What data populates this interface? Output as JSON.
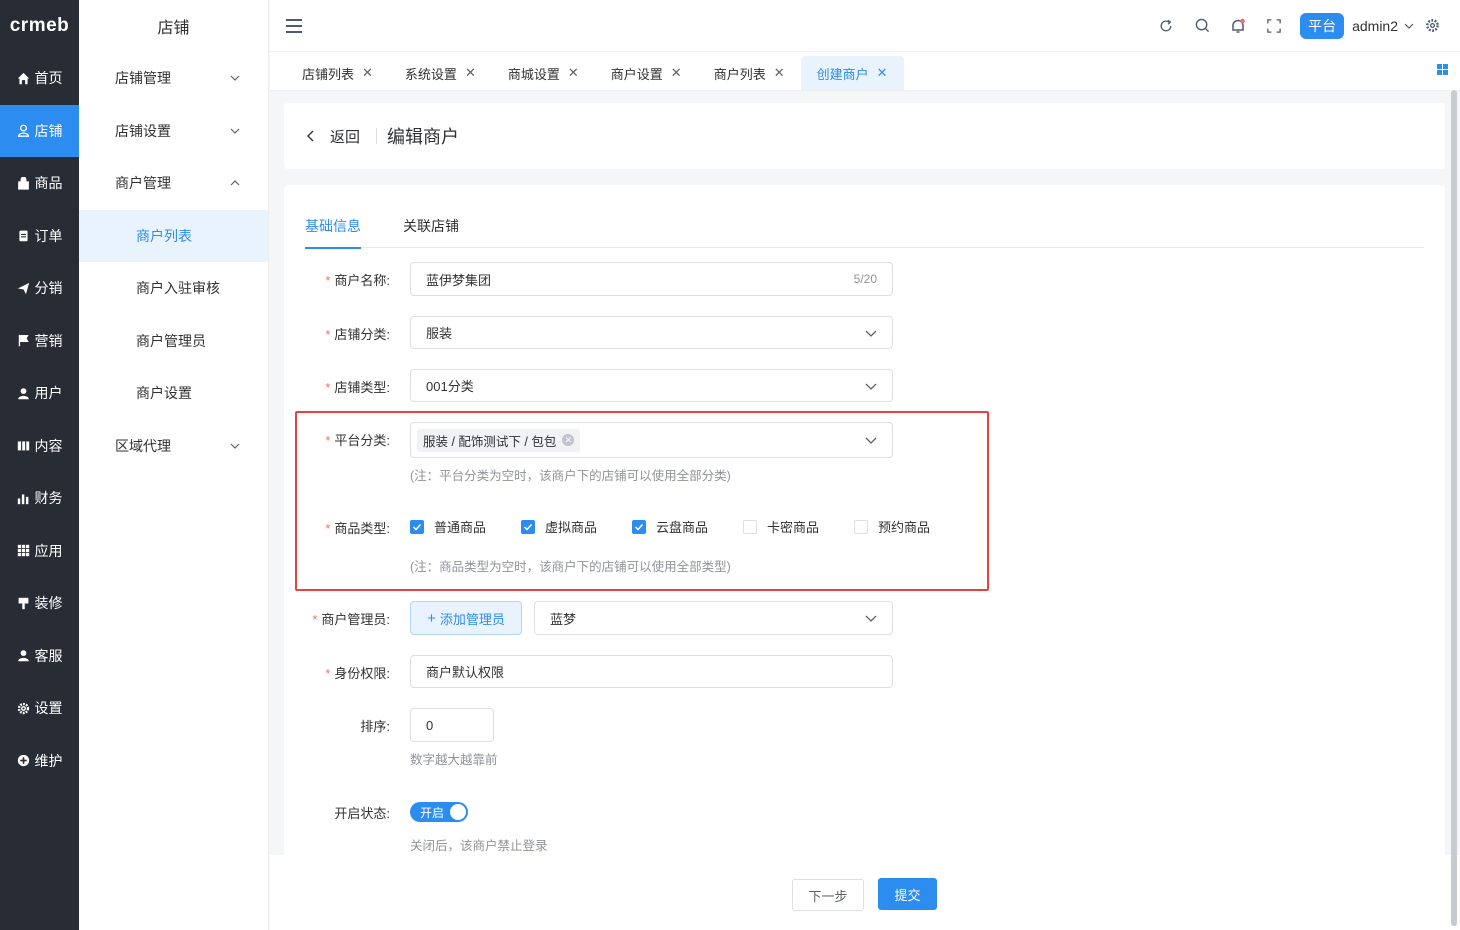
{
  "logo": "crmeb",
  "rail": {
    "items": [
      {
        "label": "首页",
        "icon": "home-icon"
      },
      {
        "label": "店铺",
        "icon": "store-icon",
        "active": true
      },
      {
        "label": "商品",
        "icon": "goods-icon"
      },
      {
        "label": "订单",
        "icon": "order-icon"
      },
      {
        "label": "分销",
        "icon": "distribution-icon"
      },
      {
        "label": "营销",
        "icon": "flag-icon"
      },
      {
        "label": "用户",
        "icon": "user-icon"
      },
      {
        "label": "内容",
        "icon": "content-icon"
      },
      {
        "label": "财务",
        "icon": "finance-icon"
      },
      {
        "label": "应用",
        "icon": "apps-icon"
      },
      {
        "label": "装修",
        "icon": "decorate-icon"
      },
      {
        "label": "客服",
        "icon": "service-icon"
      },
      {
        "label": "设置",
        "icon": "settings-icon"
      },
      {
        "label": "维护",
        "icon": "maintain-icon"
      }
    ]
  },
  "submenu": {
    "title": "店铺",
    "groups": [
      {
        "label": "店铺管理"
      },
      {
        "label": "店铺设置"
      },
      {
        "label": "商户管理"
      },
      {
        "label": "区域代理"
      }
    ],
    "items": [
      {
        "label": "商户列表",
        "active": true
      },
      {
        "label": "商户入驻审核"
      },
      {
        "label": "商户管理员"
      },
      {
        "label": "商户设置"
      }
    ]
  },
  "header": {
    "platform_label": "平台",
    "user": "admin2"
  },
  "tabs": [
    {
      "label": "店铺列表"
    },
    {
      "label": "系统设置"
    },
    {
      "label": "商城设置"
    },
    {
      "label": "商户设置"
    },
    {
      "label": "商户列表"
    },
    {
      "label": "创建商户",
      "active": true
    }
  ],
  "page": {
    "back_label": "返回",
    "title": "编辑商户"
  },
  "form_tabs": [
    {
      "label": "基础信息",
      "active": true
    },
    {
      "label": "关联店铺"
    }
  ],
  "form": {
    "merchant_name": {
      "label": "商户名称:",
      "value": "蓝伊梦集团",
      "count": "5/20"
    },
    "store_category": {
      "label": "店铺分类:",
      "value": "服装"
    },
    "store_type": {
      "label": "店铺类型:",
      "value": "001分类"
    },
    "platform_category": {
      "label": "平台分类:",
      "tag": "服装 / 配饰测试下 / 包包",
      "hint": "(注：平台分类为空时，该商户下的店铺可以使用全部分类)"
    },
    "goods_type": {
      "label": "商品类型:",
      "options": [
        {
          "label": "普通商品",
          "checked": true
        },
        {
          "label": "虚拟商品",
          "checked": true
        },
        {
          "label": "云盘商品",
          "checked": true
        },
        {
          "label": "卡密商品",
          "checked": false
        },
        {
          "label": "预约商品",
          "checked": false
        }
      ],
      "hint": "(注：商品类型为空时，该商户下的店铺可以使用全部类型)"
    },
    "admin": {
      "label": "商户管理员:",
      "add_label": "添加管理员",
      "value": "蓝梦"
    },
    "role": {
      "label": "身份权限:",
      "value": "商户默认权限"
    },
    "sort": {
      "label": "排序:",
      "value": "0",
      "hint": "数字越大越靠前"
    },
    "status": {
      "label": "开启状态:",
      "switch_label": "开启",
      "on": true,
      "hint": "关闭后，该商户禁止登录"
    }
  },
  "footer": {
    "next_label": "下一步",
    "submit_label": "提交"
  },
  "colors": {
    "accent": "#2d8cf0",
    "sidebar": "#282c34",
    "required": "#f56c6c",
    "highlight": "#e64340"
  }
}
